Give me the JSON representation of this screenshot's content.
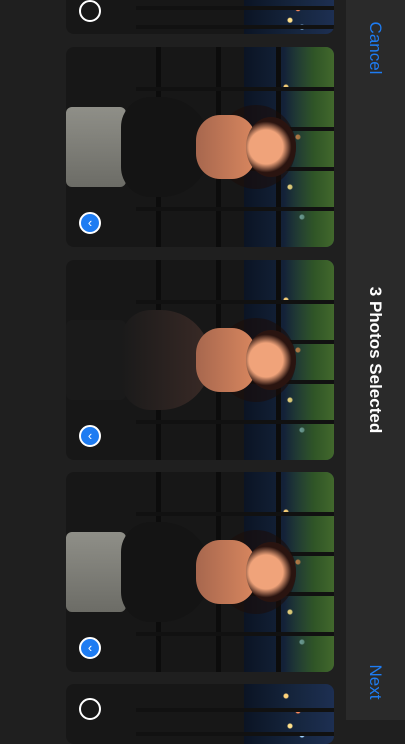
{
  "header": {
    "cancel_label": "Cancel",
    "title": "3 Photos Selected",
    "next_label": "Next"
  },
  "colors": {
    "accent": "#1e7cf2",
    "background": "#1f1f1f",
    "header_background": "#2a2a2a"
  },
  "photos": [
    {
      "selected": false,
      "indicator_icon": "empty-circle-icon"
    },
    {
      "selected": true,
      "indicator_icon": "check-circle-icon"
    },
    {
      "selected": true,
      "indicator_icon": "check-circle-icon"
    },
    {
      "selected": true,
      "indicator_icon": "check-circle-icon"
    },
    {
      "selected": false,
      "indicator_icon": "empty-circle-icon"
    }
  ],
  "selected_count": 3
}
